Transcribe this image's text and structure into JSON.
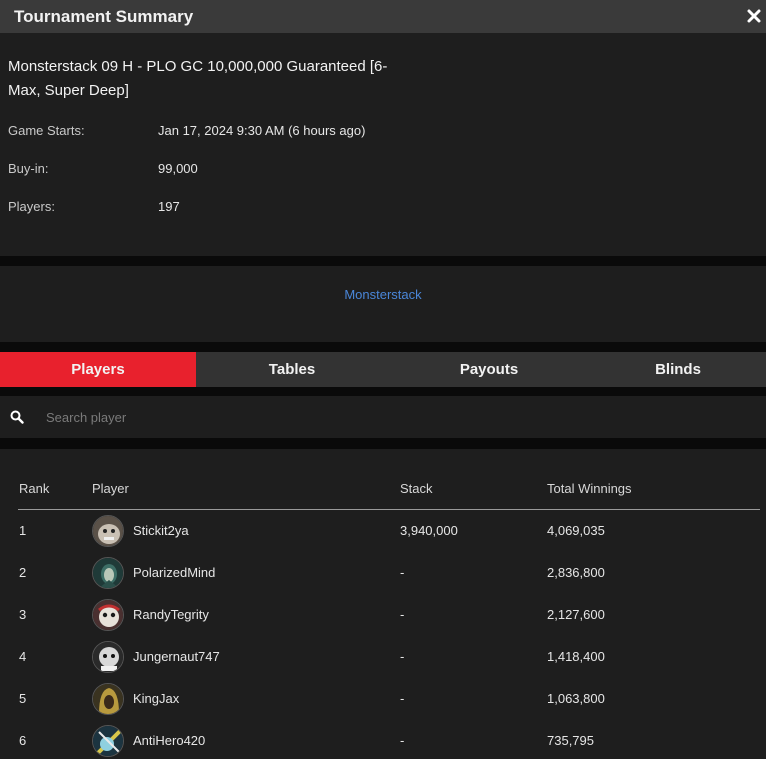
{
  "window": {
    "title": "Tournament Summary",
    "close_icon": "close-icon"
  },
  "summary": {
    "name": "Monsterstack 09 H - PLO GC 10,000,000 Guaranteed [6-Max, Super Deep]",
    "rows": [
      {
        "label": "Game Starts:",
        "value": "Jan 17, 2024 9:30 AM (6 hours ago)"
      },
      {
        "label": "Buy-in:",
        "value": "99,000"
      },
      {
        "label": "Players:",
        "value": "197"
      }
    ]
  },
  "series": {
    "link": "Monsterstack",
    "color": "#4a86d8"
  },
  "tabs": [
    {
      "label": "Players",
      "active": true
    },
    {
      "label": "Tables",
      "active": false
    },
    {
      "label": "Payouts",
      "active": false
    },
    {
      "label": "Blinds",
      "active": false
    }
  ],
  "accent": "#e8212d",
  "search": {
    "placeholder": "Search player",
    "value": "",
    "icon": "search-icon"
  },
  "table": {
    "headers": [
      "Rank",
      "Player",
      "Stack",
      "Total Winnings"
    ],
    "rows": [
      {
        "rank": "1",
        "player": "Stickit2ya",
        "stack": "3,940,000",
        "winnings": "4,069,035"
      },
      {
        "rank": "2",
        "player": "PolarizedMind",
        "stack": "-",
        "winnings": "2,836,800"
      },
      {
        "rank": "3",
        "player": "RandyTegrity",
        "stack": "-",
        "winnings": "2,127,600"
      },
      {
        "rank": "4",
        "player": "Jungernaut747",
        "stack": "-",
        "winnings": "1,418,400"
      },
      {
        "rank": "5",
        "player": "KingJax",
        "stack": "-",
        "winnings": "1,063,800"
      },
      {
        "rank": "6",
        "player": "AntiHero420",
        "stack": "-",
        "winnings": "735,795"
      }
    ]
  }
}
